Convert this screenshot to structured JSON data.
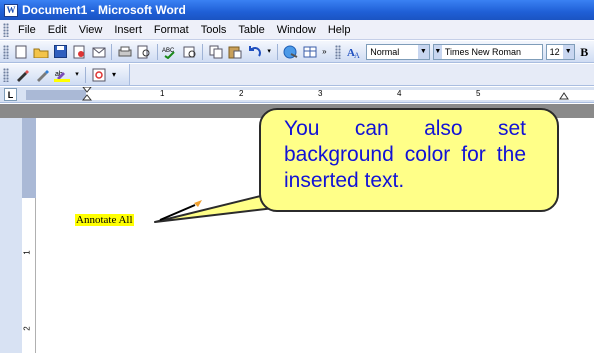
{
  "window": {
    "title": "Document1 - Microsoft Word",
    "app_icon": "W"
  },
  "menu": {
    "items": [
      "File",
      "Edit",
      "View",
      "Insert",
      "Format",
      "Tools",
      "Table",
      "Window",
      "Help"
    ]
  },
  "formatting": {
    "style": "Normal",
    "font": "Times New Roman",
    "size": "12",
    "bold_label": "B"
  },
  "ruler": {
    "numbers": [
      "1",
      "2",
      "3",
      "4",
      "5"
    ]
  },
  "vruler": {
    "numbers": [
      "1",
      "2"
    ]
  },
  "document": {
    "annotated_text": "Annotate All",
    "highlight_color": "#ffff00"
  },
  "callout": {
    "text": "You can also set background color for the inserted text.",
    "fill": "#ffff88",
    "text_color": "#1212d6"
  },
  "colors": {
    "title_bar": "#1f5fd6",
    "toolbar": "#cfdcf3"
  }
}
